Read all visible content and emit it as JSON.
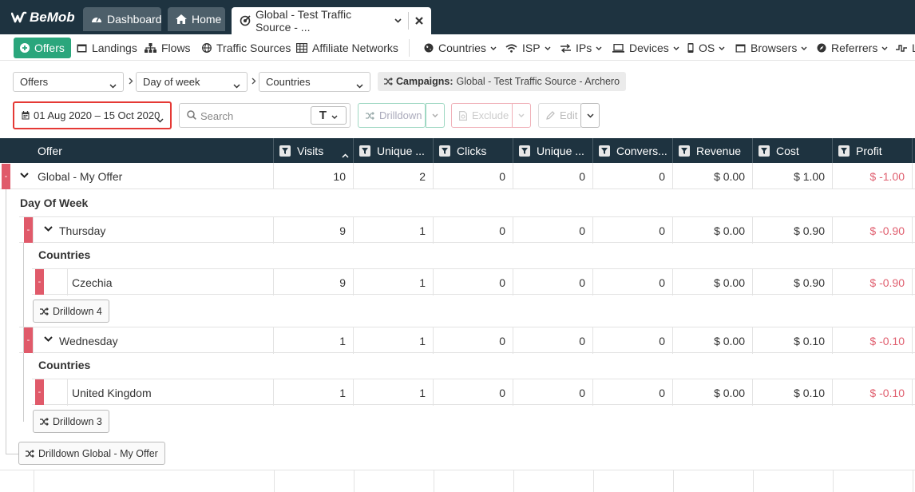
{
  "topbar": {
    "logo": "BeMob",
    "tabs": [
      {
        "label": "Dashboard",
        "icon": "gauge-icon"
      },
      {
        "label": "Home",
        "icon": "home-icon"
      },
      {
        "label": "Global - Test Traffic Source - ...",
        "icon": "target-icon"
      }
    ]
  },
  "nav": {
    "items": [
      {
        "label": "Offers",
        "icon": "plus-circle-icon",
        "active": true
      },
      {
        "label": "Landings",
        "icon": "landing-icon"
      },
      {
        "label": "Flows",
        "icon": "sitemap-icon"
      },
      {
        "label": "Traffic Sources",
        "icon": "globe-icon"
      },
      {
        "label": "Affiliate Networks",
        "icon": "network-icon"
      },
      {
        "label": "Countries",
        "icon": "globe-icon"
      },
      {
        "label": "ISP",
        "icon": "wifi-icon"
      },
      {
        "label": "IPs",
        "icon": "arrows-icon"
      },
      {
        "label": "Devices",
        "icon": "laptop-icon"
      },
      {
        "label": "OS",
        "icon": "mobile-icon"
      },
      {
        "label": "Browsers",
        "icon": "window-icon"
      },
      {
        "label": "Referrers",
        "icon": "compass-icon"
      },
      {
        "label": "L",
        "icon": "chart-icon"
      }
    ]
  },
  "breadcrumb": {
    "level1": "Offers",
    "level2": "Day of week",
    "level3": "Countries",
    "campaign_prefix": "Campaigns:",
    "campaign_value": "Global - Test Traffic Source - Archero"
  },
  "toolbar": {
    "date_range": "01 Aug 2020 – 15 Oct 2020",
    "search_placeholder": "Search",
    "text_filter": "T",
    "drilldown": "Drilldown",
    "exclude": "Exclude",
    "edit": "Edit"
  },
  "table": {
    "columns": [
      "Offer",
      "Visits",
      "Unique ...",
      "Clicks",
      "Unique ...",
      "Convers...",
      "Revenue",
      "Cost",
      "Profit"
    ],
    "rows": [
      {
        "name": "Global - My Offer",
        "values": [
          "10",
          "2",
          "0",
          "0",
          "0",
          "$ 0.00",
          "$ 1.00",
          "$ -1.00"
        ]
      },
      {
        "name": "Thursday",
        "values": [
          "9",
          "1",
          "0",
          "0",
          "0",
          "$ 0.00",
          "$ 0.90",
          "$ -0.90"
        ]
      },
      {
        "name": "Czechia",
        "values": [
          "9",
          "1",
          "0",
          "0",
          "0",
          "$ 0.00",
          "$ 0.90",
          "$ -0.90"
        ]
      },
      {
        "name": "Wednesday",
        "values": [
          "1",
          "1",
          "0",
          "0",
          "0",
          "$ 0.00",
          "$ 0.10",
          "$ -0.10"
        ]
      },
      {
        "name": "United Kingdom",
        "values": [
          "1",
          "1",
          "0",
          "0",
          "0",
          "$ 0.00",
          "$ 0.10",
          "$ -0.10"
        ]
      }
    ],
    "group_labels": [
      "Day Of Week",
      "Countries",
      "Countries"
    ],
    "drill_buttons": [
      "Drilldown 4",
      "Drilldown 3",
      "Drilldown Global - My Offer"
    ],
    "minus": "-"
  }
}
